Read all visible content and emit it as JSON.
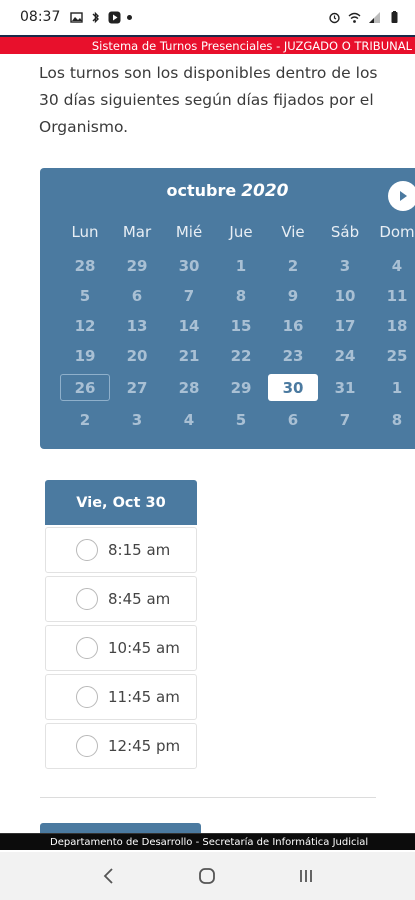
{
  "status_bar": {
    "time": "08:37",
    "left_icons": [
      "image-icon",
      "bluetooth-icon",
      "play-icon",
      "dot-icon"
    ],
    "right_icons": [
      "alarm-icon",
      "wifi-icon",
      "signal-icon",
      "battery-icon"
    ]
  },
  "banner_top": {
    "text": "Sistema de Turnos Presenciales - JUZGADO O TRIBUNAL"
  },
  "intro": {
    "text": "Los turnos son los disponibles dentro de los 30 días siguientes según días fijados por el Organismo."
  },
  "calendar": {
    "month": "octubre",
    "year": "2020",
    "next_icon": "chevron-right-icon",
    "weekdays": [
      "Lun",
      "Mar",
      "Mié",
      "Jue",
      "Vie",
      "Sáb",
      "Dom"
    ],
    "weeks": [
      [
        "28",
        "29",
        "30",
        "1",
        "2",
        "3",
        "4"
      ],
      [
        "5",
        "6",
        "7",
        "8",
        "9",
        "10",
        "11"
      ],
      [
        "12",
        "13",
        "14",
        "15",
        "16",
        "17",
        "18"
      ],
      [
        "19",
        "20",
        "21",
        "22",
        "23",
        "24",
        "25"
      ],
      [
        "26",
        "27",
        "28",
        "29",
        "30",
        "31",
        "1"
      ],
      [
        "2",
        "3",
        "4",
        "5",
        "6",
        "7",
        "8"
      ]
    ],
    "today": "26",
    "selected": "30",
    "accent_color": "#4b7aa0"
  },
  "times": {
    "header": "Vie, Oct 30",
    "slots": [
      "8:15 am",
      "8:45 am",
      "10:45 am",
      "11:45 am",
      "12:45 pm"
    ]
  },
  "banner_bottom": {
    "text": "Departamento de Desarrollo - Secretaría de Informática Judicial"
  },
  "nav_bar": {
    "buttons": [
      "back-icon",
      "home-icon",
      "recents-icon"
    ]
  }
}
